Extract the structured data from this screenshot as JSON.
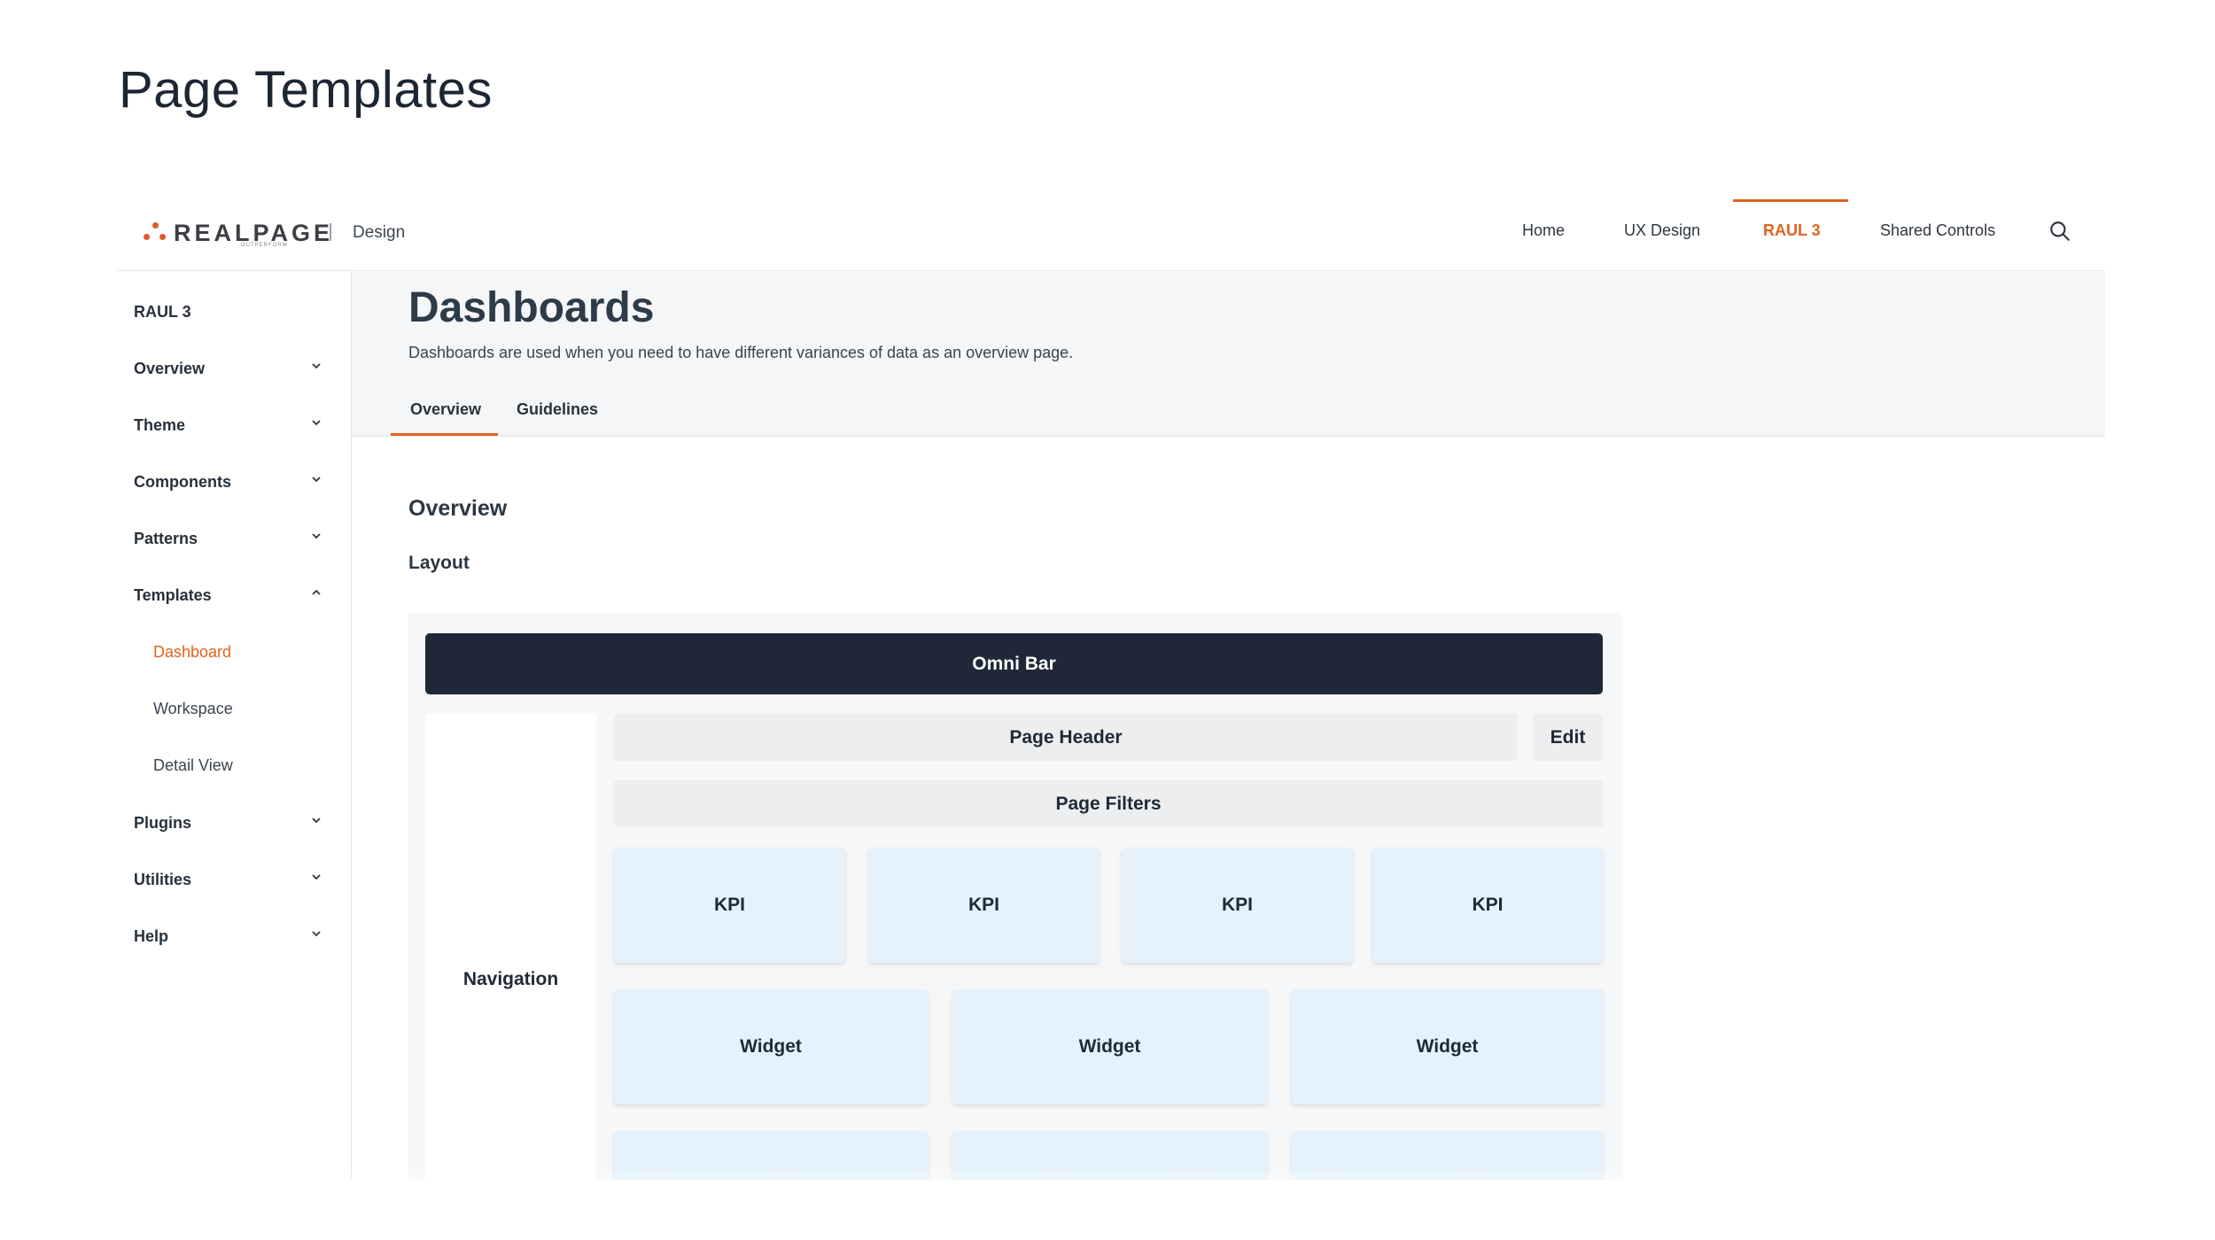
{
  "page_title": "Page Templates",
  "topbar": {
    "logo_text": "REALPAGE",
    "logo_sub": "OUTPERFORM",
    "product": "Design",
    "nav": [
      "Home",
      "UX Design",
      "RAUL 3",
      "Shared Controls"
    ],
    "active_nav": "RAUL 3",
    "search_icon": "search-icon"
  },
  "sidebar": {
    "heading": "RAUL 3",
    "items": [
      "Overview",
      "Theme",
      "Components",
      "Patterns",
      "Templates"
    ],
    "template_children": [
      "Dashboard",
      "Workspace",
      "Detail View"
    ],
    "active_child": "Dashboard",
    "items_after": [
      "Plugins",
      "Utilities",
      "Help"
    ]
  },
  "header": {
    "title": "Dashboards",
    "description": "Dashboards are used when you need to have different variances of data as an overview page.",
    "tabs": [
      "Overview",
      "Guidelines"
    ],
    "active_tab": "Overview"
  },
  "content": {
    "section_title": "Overview",
    "subsection": "Layout"
  },
  "layout_diagram": {
    "omni_bar": "Omni Bar",
    "navigation": "Navigation",
    "page_header": "Page Header",
    "edit": "Edit",
    "page_filters": "Page Filters",
    "kpis": [
      "KPI",
      "KPI",
      "KPI",
      "KPI"
    ],
    "widgets": [
      "Widget",
      "Widget",
      "Widget"
    ]
  },
  "colors": {
    "accent": "#e0631e",
    "omni_bar": "#1f2838",
    "tile": "#e5f2fc"
  }
}
